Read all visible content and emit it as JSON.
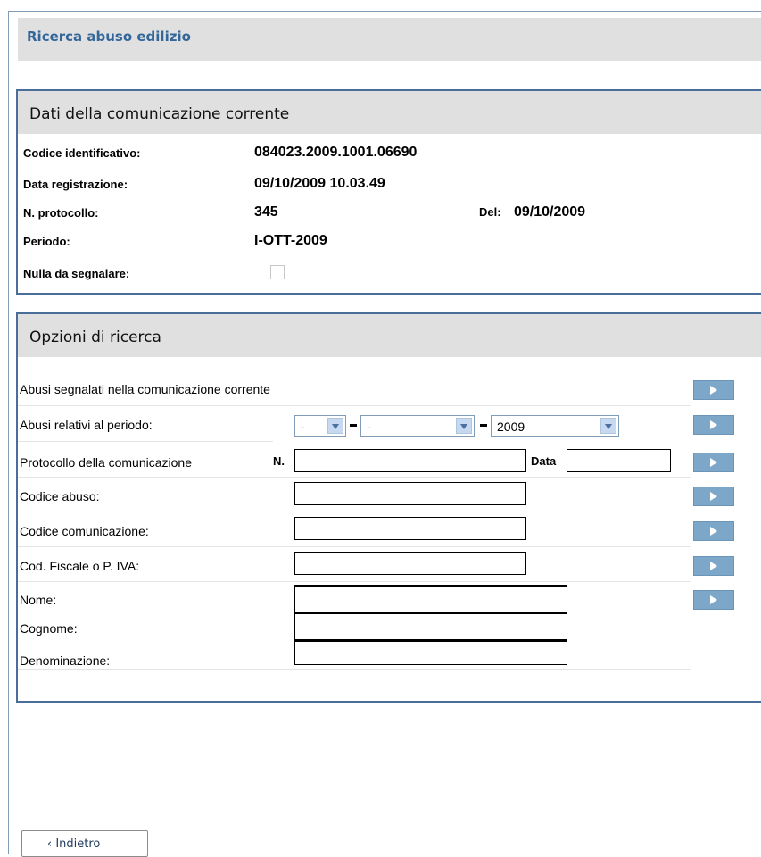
{
  "page": {
    "title": "Ricerca abuso edilizio"
  },
  "communication": {
    "header": "Dati della comunicazione corrente",
    "fields": {
      "codice_label": "Codice identificativo:",
      "codice_value": "084023.2009.1001.06690",
      "data_label": "Data registrazione:",
      "data_value": "09/10/2009 10.03.49",
      "protocollo_label": "N. protocollo:",
      "protocollo_value": "345",
      "del_label": "Del:",
      "del_value": "09/10/2009",
      "periodo_label": "Periodo:",
      "periodo_value": "I-OTT-2009",
      "nulla_label": "Nulla da segnalare:",
      "nulla_checked": false
    }
  },
  "search": {
    "header": "Opzioni di ricerca",
    "rows": {
      "abusi_segnalati": "Abusi segnalati nella comunicazione corrente",
      "abusi_periodo": "Abusi relativi al periodo:",
      "protocollo": "Protocollo della comunicazione",
      "codice_abuso": "Codice abuso:",
      "codice_comunicazione": "Codice comunicazione:",
      "cod_fiscale": "Cod. Fiscale o P. IVA:",
      "nome": "Nome:",
      "cognome": "Cognome:",
      "denominazione": "Denominazione:"
    },
    "period_selects": {
      "first": "-",
      "second": "-",
      "year": "2009"
    },
    "n_label": "N.",
    "data_label": "Data",
    "inputs": {
      "protocollo_n": "",
      "protocollo_data": "",
      "codice_abuso": "",
      "codice_comunicazione": "",
      "cod_fiscale": "",
      "nome": "",
      "cognome": "",
      "denominazione": ""
    }
  },
  "footer": {
    "back_label": "‹ Indietro"
  }
}
